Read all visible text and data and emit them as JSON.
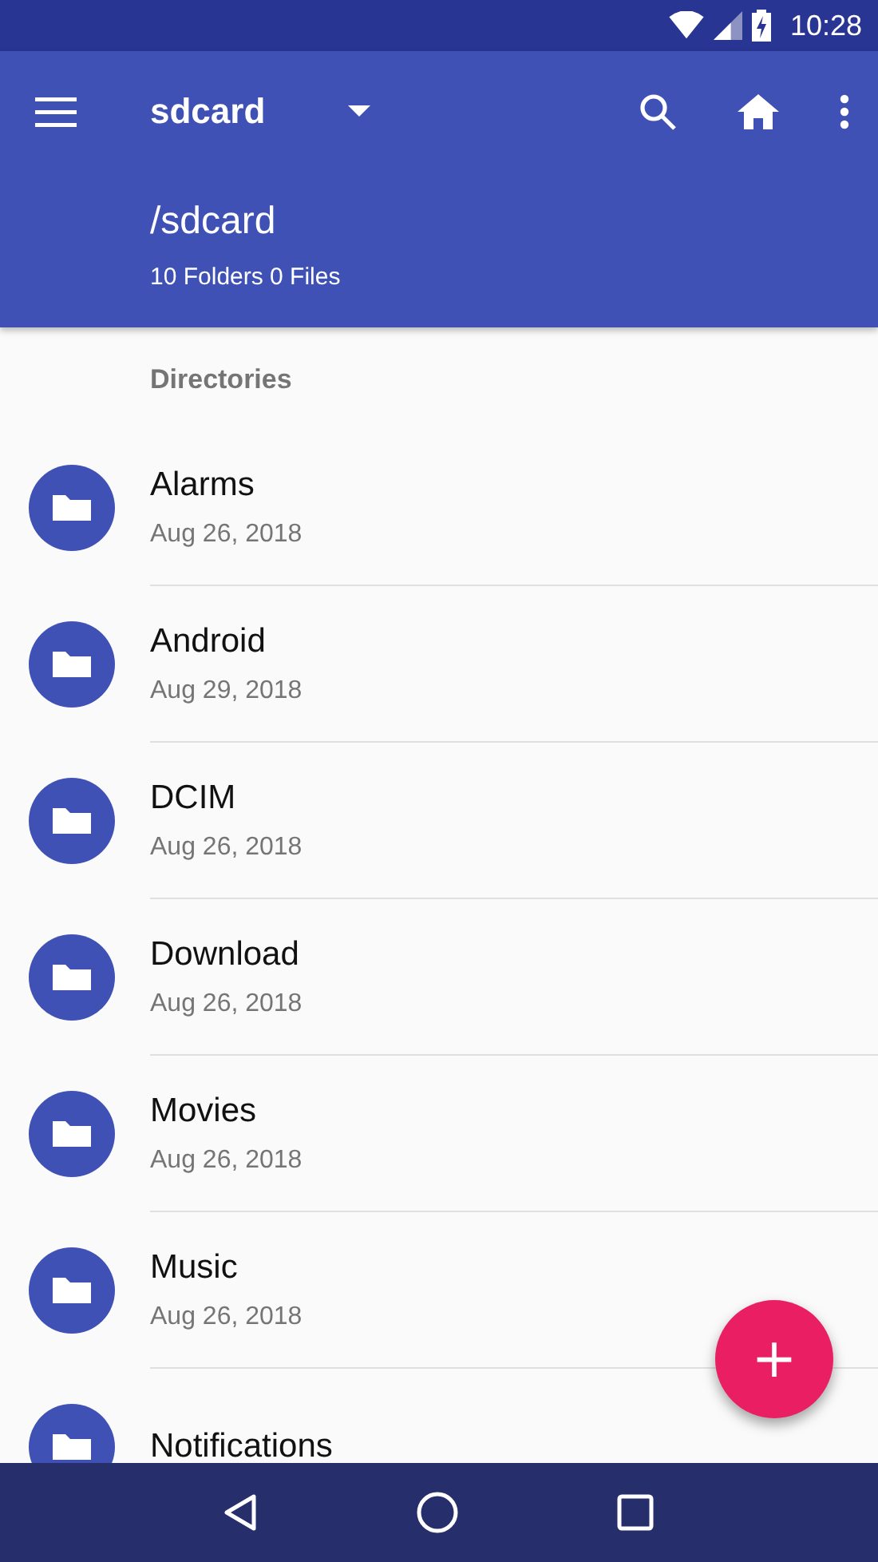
{
  "status_bar": {
    "time": "10:28"
  },
  "toolbar": {
    "title": "sdcard"
  },
  "header": {
    "path": "/sdcard",
    "summary": "10 Folders 0 Files"
  },
  "section": {
    "title": "Directories"
  },
  "folders": [
    {
      "name": "Alarms",
      "date": "Aug 26, 2018"
    },
    {
      "name": "Android",
      "date": "Aug 29, 2018"
    },
    {
      "name": "DCIM",
      "date": "Aug 26, 2018"
    },
    {
      "name": "Download",
      "date": "Aug 26, 2018"
    },
    {
      "name": "Movies",
      "date": "Aug 26, 2018"
    },
    {
      "name": "Music",
      "date": "Aug 26, 2018"
    },
    {
      "name": "Notifications"
    }
  ],
  "fab": {
    "label": "+"
  }
}
